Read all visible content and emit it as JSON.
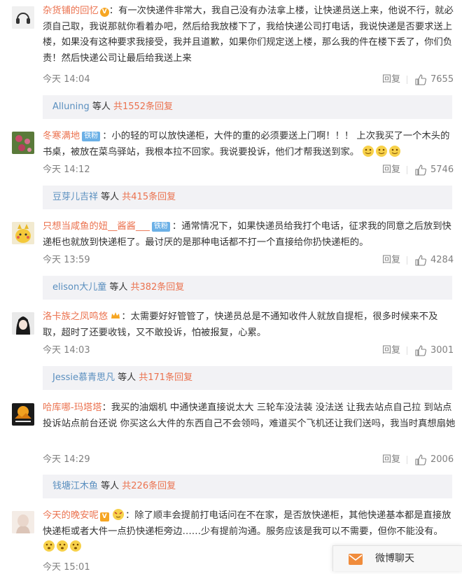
{
  "comments": [
    {
      "user": "杂货铺的回忆",
      "badge": "",
      "text": "：有一次快递件非常大，我自己没有办法拿上楼，让快递员送上来，他说不行，就必须自己取，我说那就你看着办吧，然后给我放楼下了，我给快递公司打电话，我说快递是否要求送上楼，如果没有这种要求我接受，我并且道歉，如果你们规定送上楼，那么我的件在楼下丢了，你们负责！然后快递公司让最后给我送上来",
      "time": "今天 14:04",
      "reply": "回复",
      "likes": "7655",
      "sub_user": "Alluning",
      "sub_mid": " 等人 ",
      "sub_link": "共1552条回复"
    },
    {
      "user": "冬寒满地",
      "badge": "铁粉",
      "text": "：小的轻的可以放快递柜，大件的重的必须要送上门啊！！！ 上次我买了一个木头的书桌，被放在菜鸟驿站，我根本拉不回家。我说要投诉，他们才帮我送到家。",
      "time": "今天 14:12",
      "reply": "回复",
      "likes": "5746",
      "sub_user": "豆芽儿吉祥",
      "sub_mid": " 等人 ",
      "sub_link": "共415条回复"
    },
    {
      "user": "只想当咸鱼的妞__酱酱___",
      "badge": "铁粉",
      "text": "：通常情况下，如果快递员给我打个电话，征求我的同意之后放到快递柜也就放到快递柜了。最讨厌的是那种电话都不打一个直接给你扔快递柜的。",
      "time": "今天 13:59",
      "reply": "回复",
      "likes": "4284",
      "sub_user": "elison大儿童",
      "sub_mid": " 等人 ",
      "sub_link": "共382条回复"
    },
    {
      "user": "洛卡族之凤鸣悠",
      "badge": "",
      "text": "：太需要好好管管了，快递员总是不通知收件人就放自提柜，很多时候来不及取，超时了还要收钱，又不敢投诉，怕被报复，心累。",
      "time": "今天 14:03",
      "reply": "回复",
      "likes": "3001",
      "sub_user": "Jessie慕青思凡",
      "sub_mid": " 等人 ",
      "sub_link": "共171条回复"
    },
    {
      "user": "哈库哪-玛塔塔",
      "badge": "",
      "text": "：我买的油烟机 中通快递直接说太大 三轮车没法装 没法送 让我去站点自己拉  到站点投诉站点前台还说 你买这么大件的东西自己不会领吗，难道买个飞机还让我们送吗，我当时真想扇她",
      "time": "今天 14:29",
      "reply": "回复",
      "likes": "2006",
      "sub_user": "钱塘江木鱼",
      "sub_mid": " 等人 ",
      "sub_link": "共226条回复"
    },
    {
      "user": "今天的晚安呢",
      "badge": "",
      "text": "：除了顺丰会提前打电话问在不在家，是否放快递柜，其他快递基本都是直接放快递柜或者大件一点扔快递柜旁边……少有提前沟通。服务应该是我可以不需要，但你不能没有。",
      "time": "今天 15:01",
      "reply": "回复",
      "likes": "",
      "sub_user": "",
      "sub_mid": "",
      "sub_link": ""
    }
  ],
  "chat": {
    "label": "微博聊天"
  },
  "colors": {
    "accent": "#eb7350",
    "muted": "#808080",
    "subbox_bg": "#f2f2f5",
    "badge": "#6bb0e6"
  },
  "icons": {
    "like": "thumbs-up-icon",
    "chat": "mail-icon",
    "vip": "v-badge-icon"
  }
}
